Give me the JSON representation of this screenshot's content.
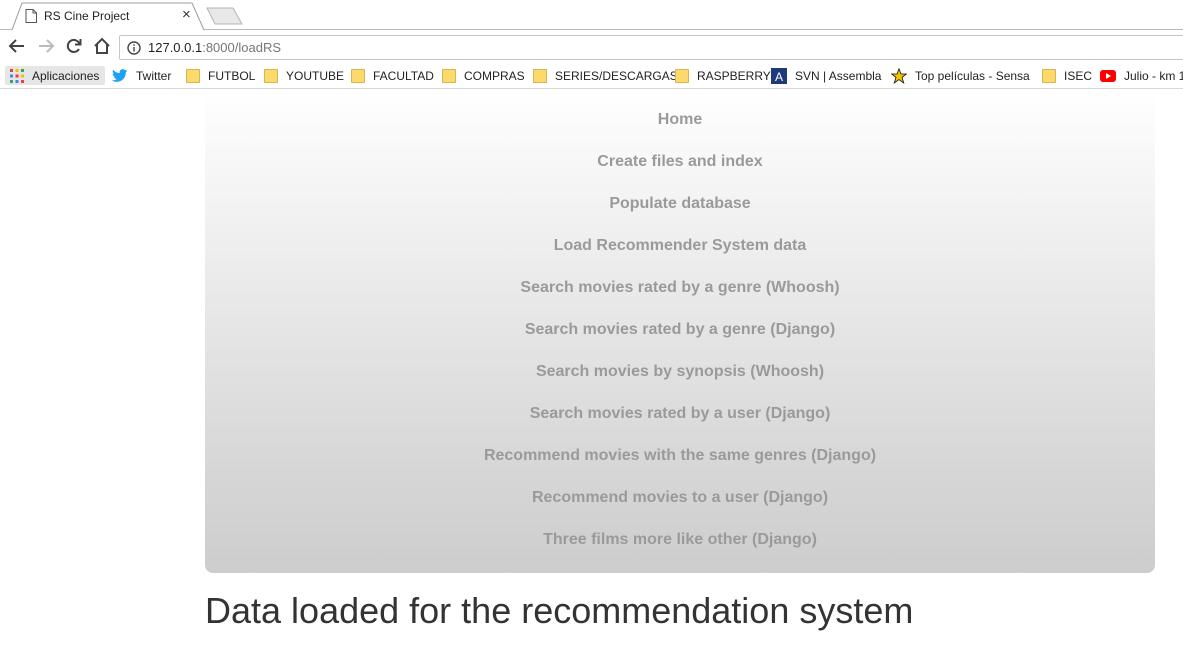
{
  "browser": {
    "tab_title": "RS Cine Project",
    "tab_close": "×",
    "url_host": "127.0.0.1",
    "url_rest": ":8000/loadRS",
    "bookmarks": {
      "apps": "Aplicaciones",
      "twitter": "Twitter",
      "futbol": "FUTBOL",
      "youtube": "YOUTUBE",
      "facultad": "FACULTAD",
      "compras": "COMPRAS",
      "series": "SERIES/DESCARGAS",
      "raspberry": "RASPBERRY",
      "svn": "SVN | Assembla",
      "top": "Top películas - Sensa",
      "isec": "ISEC",
      "julio": "Julio - km 1"
    }
  },
  "nav": {
    "items": [
      "Home",
      "Create files and index",
      "Populate database",
      "Load Recommender System data",
      "Search movies rated by a genre (Whoosh)",
      "Search movies rated by a genre (Django)",
      "Search movies by synopsis (Whoosh)",
      "Search movies rated by a user (Django)",
      "Recommend movies with the same genres (Django)",
      "Recommend movies to a user (Django)",
      "Three films more like other (Django)"
    ]
  },
  "main": {
    "heading": "Data loaded for the recommendation system"
  },
  "colors": {
    "nav_link": "#9a9a9a",
    "heading": "#333333",
    "twitter": "#1da1f2",
    "youtube": "#ff0000",
    "folder": "#fbd96a"
  }
}
